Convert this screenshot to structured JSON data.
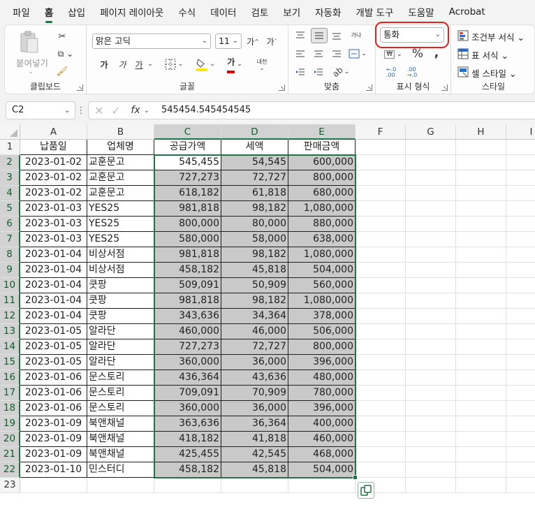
{
  "ribbon_tabs": [
    "파일",
    "홈",
    "삽입",
    "페이지 레이아웃",
    "수식",
    "데이터",
    "검토",
    "보기",
    "자동화",
    "개발 도구",
    "도움말",
    "Acrobat"
  ],
  "clipboard": {
    "paste_label": "붙여넣기",
    "group_label": "클립보드"
  },
  "font": {
    "name": "맑은 고딕",
    "size": "11",
    "group_label": "글꼴",
    "bold": "가",
    "italic": "가",
    "underline": "가",
    "font_color_glyph": "가",
    "grow": "가^",
    "shrink": "가ˇ",
    "phonetic": "내천"
  },
  "alignment": {
    "group_label": "맞춤",
    "wrap": "가나"
  },
  "number": {
    "format": "통화",
    "group_label": "표시 형식",
    "percent": "%",
    "comma": "9"
  },
  "styles": {
    "conditional": "조건부 서식",
    "table": "표 서식",
    "cell": "셀 스타일",
    "group_label": "스타일"
  },
  "formula_bar": {
    "name_box": "C2",
    "fx": "fx",
    "value": "545454.545454545"
  },
  "columns": [
    "A",
    "B",
    "C",
    "D",
    "E",
    "F",
    "G",
    "H",
    "I"
  ],
  "selected_columns": [
    "C",
    "D",
    "E"
  ],
  "headers": [
    "납품일",
    "업체명",
    "공급가액",
    "세액",
    "판매금액"
  ],
  "rows": [
    [
      "2023-01-02",
      "교훈문고",
      "545,455",
      "54,545",
      "600,000"
    ],
    [
      "2023-01-02",
      "교훈문고",
      "727,273",
      "72,727",
      "800,000"
    ],
    [
      "2023-01-02",
      "교훈문고",
      "618,182",
      "61,818",
      "680,000"
    ],
    [
      "2023-01-03",
      "YES25",
      "981,818",
      "98,182",
      "1,080,000"
    ],
    [
      "2023-01-03",
      "YES25",
      "800,000",
      "80,000",
      "880,000"
    ],
    [
      "2023-01-03",
      "YES25",
      "580,000",
      "58,000",
      "638,000"
    ],
    [
      "2023-01-04",
      "비상서점",
      "981,818",
      "98,182",
      "1,080,000"
    ],
    [
      "2023-01-04",
      "비상서점",
      "458,182",
      "45,818",
      "504,000"
    ],
    [
      "2023-01-04",
      "쿳팡",
      "509,091",
      "50,909",
      "560,000"
    ],
    [
      "2023-01-04",
      "쿳팡",
      "981,818",
      "98,182",
      "1,080,000"
    ],
    [
      "2023-01-04",
      "쿳팡",
      "343,636",
      "34,364",
      "378,000"
    ],
    [
      "2023-01-05",
      "알라단",
      "460,000",
      "46,000",
      "506,000"
    ],
    [
      "2023-01-05",
      "알라단",
      "727,273",
      "72,727",
      "800,000"
    ],
    [
      "2023-01-05",
      "알라단",
      "360,000",
      "36,000",
      "396,000"
    ],
    [
      "2023-01-06",
      "문스토리",
      "436,364",
      "43,636",
      "480,000"
    ],
    [
      "2023-01-06",
      "문스토리",
      "709,091",
      "70,909",
      "780,000"
    ],
    [
      "2023-01-06",
      "문스토리",
      "360,000",
      "36,000",
      "396,000"
    ],
    [
      "2023-01-09",
      "북앤채널",
      "363,636",
      "36,364",
      "400,000"
    ],
    [
      "2023-01-09",
      "북앤채널",
      "418,182",
      "41,818",
      "460,000"
    ],
    [
      "2023-01-09",
      "북앤채널",
      "425,455",
      "42,545",
      "468,000"
    ],
    [
      "2023-01-10",
      "민스터디",
      "458,182",
      "45,818",
      "504,000"
    ]
  ],
  "row_numbers": [
    "1",
    "2",
    "3",
    "4",
    "5",
    "6",
    "7",
    "8",
    "9",
    "10",
    "11",
    "12",
    "13",
    "14",
    "15",
    "16",
    "17",
    "18",
    "19",
    "20",
    "21",
    "22",
    "23"
  ],
  "colors": {
    "accent": "#217346",
    "highlight_circle": "#e0241b",
    "selection_fill": "#c9c9c9"
  }
}
